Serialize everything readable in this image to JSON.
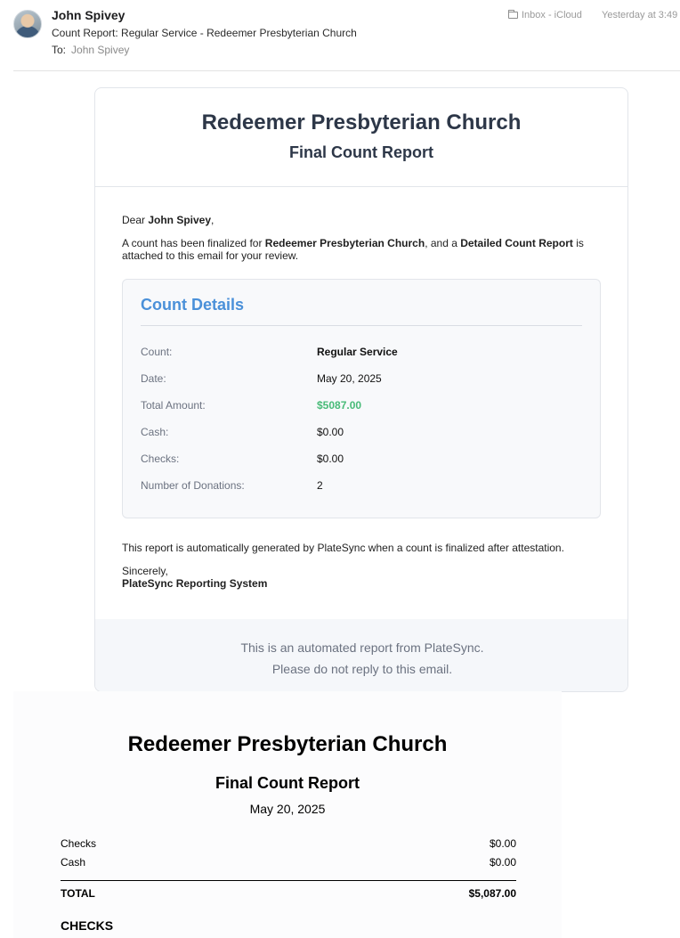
{
  "mail": {
    "sender": "John Spivey",
    "subject": "Count Report: Regular Service - Redeemer Presbyterian Church",
    "to_label": "To:",
    "to_name": "John Spivey",
    "mailbox": "Inbox - iCloud",
    "timestamp": "Yesterday at 3:49"
  },
  "email": {
    "church_name": "Redeemer Presbyterian Church",
    "report_title": "Final Count Report",
    "greeting_prefix": "Dear ",
    "recipient": "John Spivey",
    "greeting_suffix": ",",
    "intro_1": "A count has been finalized for ",
    "intro_church": "Redeemer Presbyterian Church",
    "intro_2": ", and a ",
    "intro_report": "Detailed Count Report",
    "intro_3": " is attached to this email for your review.",
    "details_title": "Count Details",
    "details": [
      {
        "label": "Count:",
        "value": "Regular Service"
      },
      {
        "label": "Date:",
        "value": "May 20, 2025"
      },
      {
        "label": "Total Amount:",
        "value": "$5087.00"
      },
      {
        "label": "Cash:",
        "value": "$0.00"
      },
      {
        "label": "Checks:",
        "value": "$0.00"
      },
      {
        "label": "Number of Donations:",
        "value": "2"
      }
    ],
    "auto_note": "This report is automatically generated by PlateSync when a count is finalized after attestation.",
    "sincerely": "Sincerely,",
    "signature": "PlateSync Reporting System",
    "footer_line1": "This is an automated report from PlateSync.",
    "footer_line2": "Please do not reply to this email."
  },
  "attachment": {
    "church_name": "Redeemer Presbyterian Church",
    "report_title": "Final Count Report",
    "date": "May 20, 2025",
    "rows": [
      {
        "label": "Checks",
        "value": "$0.00"
      },
      {
        "label": "Cash",
        "value": "$0.00"
      }
    ],
    "total_label": "TOTAL",
    "total_value": "$5,087.00",
    "section_heading": "CHECKS"
  },
  "colors": {
    "heading": "#2d3748",
    "details_title": "#4a90d9",
    "total_amount": "#48bb78",
    "muted": "#6b7280"
  }
}
